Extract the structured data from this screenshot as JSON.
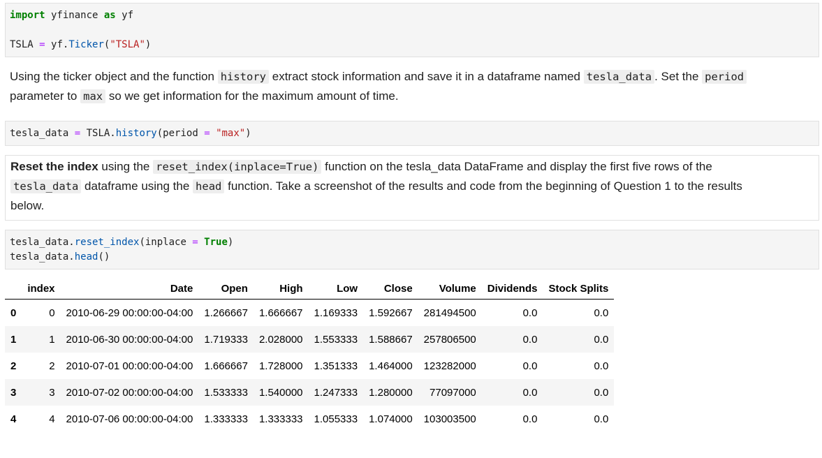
{
  "code1": {
    "line1": {
      "kw1": "import",
      "mod": " yfinance ",
      "kw2": "as",
      "alias": " yf"
    },
    "line2": {
      "var": "TSLA ",
      "eq": "=",
      "obj": " yf.",
      "fn": "Ticker",
      "open": "(",
      "str": "\"TSLA\"",
      "close": ")"
    }
  },
  "md1": {
    "t1": "Using the ticker object and the function ",
    "c1": "history",
    "t2": " extract stock information and save it in a dataframe named ",
    "c2": "tesla_data",
    "t3": ". Set the ",
    "c3": "period",
    "t4": "parameter to ",
    "c4": "max",
    "t5": " so we get information for the maximum amount of time."
  },
  "code2": {
    "var": "tesla_data ",
    "eq": "=",
    "obj": " TSLA.",
    "fn": "history",
    "open": "(period ",
    "eq2": "=",
    "sp": " ",
    "str": "\"max\"",
    "close": ")"
  },
  "md2": {
    "bold": "Reset the index",
    "t1": " using the ",
    "c1": "reset_index(inplace=True)",
    "t2": " function on the tesla_data DataFrame and display the first five rows of the",
    "c2": "tesla_data",
    "t3": " dataframe using the ",
    "c3": "head",
    "t4": " function. Take a screenshot of the results and code from the beginning of Question 1 to the results",
    "t5": "below."
  },
  "code3": {
    "line1": {
      "obj": "tesla_data.",
      "fn": "reset_index",
      "open": "(inplace ",
      "eq": "=",
      "sp": " ",
      "kw": "True",
      "close": ")"
    },
    "line2": {
      "obj": "tesla_data.",
      "fn": "head",
      "paren": "()"
    }
  },
  "table": {
    "columns": [
      "",
      "index",
      "Date",
      "Open",
      "High",
      "Low",
      "Close",
      "Volume",
      "Dividends",
      "Stock Splits"
    ],
    "rows": [
      [
        "0",
        "0",
        "2010-06-29 00:00:00-04:00",
        "1.266667",
        "1.666667",
        "1.169333",
        "1.592667",
        "281494500",
        "0.0",
        "0.0"
      ],
      [
        "1",
        "1",
        "2010-06-30 00:00:00-04:00",
        "1.719333",
        "2.028000",
        "1.553333",
        "1.588667",
        "257806500",
        "0.0",
        "0.0"
      ],
      [
        "2",
        "2",
        "2010-07-01 00:00:00-04:00",
        "1.666667",
        "1.728000",
        "1.351333",
        "1.464000",
        "123282000",
        "0.0",
        "0.0"
      ],
      [
        "3",
        "3",
        "2010-07-02 00:00:00-04:00",
        "1.533333",
        "1.540000",
        "1.247333",
        "1.280000",
        "77097000",
        "0.0",
        "0.0"
      ],
      [
        "4",
        "4",
        "2010-07-06 00:00:00-04:00",
        "1.333333",
        "1.333333",
        "1.055333",
        "1.074000",
        "103003500",
        "0.0",
        "0.0"
      ]
    ]
  }
}
